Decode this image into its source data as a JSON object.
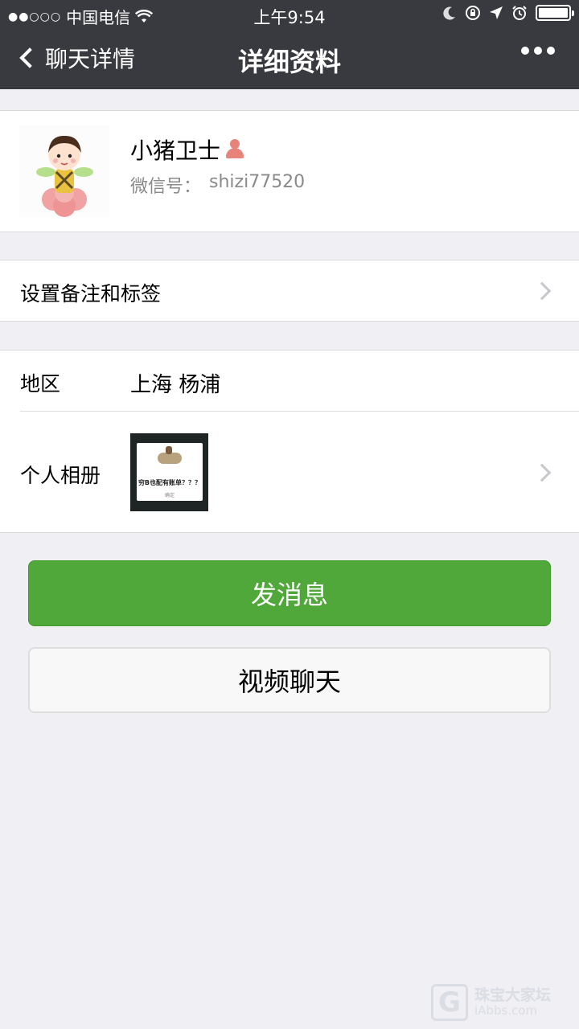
{
  "status_bar": {
    "signal": "●●○○○",
    "carrier": "中国电信",
    "wifi_icon": "wifi-icon",
    "time": "上午9:54",
    "icons": [
      "moon-icon",
      "rotation-lock-icon",
      "location-arrow-icon",
      "alarm-icon",
      "battery-icon"
    ]
  },
  "nav": {
    "back_label": "聊天详情",
    "title": "详细资料",
    "more_icon": "more-dots-icon"
  },
  "profile": {
    "name": "小猪卫士",
    "gender_icon": "female-icon",
    "wechat_id_label": "微信号：",
    "wechat_id": "shizi77520"
  },
  "remark": {
    "label": "设置备注和标签"
  },
  "info": {
    "region_label": "地区",
    "region_value": "上海  杨浦",
    "album_label": "个人相册",
    "album_thumb_text": "穷B也配有账单？？？",
    "album_thumb_button": "确定"
  },
  "actions": {
    "send_label": "发消息",
    "video_label": "视频聊天"
  },
  "watermark": {
    "title": "珠宝大家坛",
    "subtitle": "iAbbs.com"
  },
  "colors": {
    "nav_bg": "#393a3f",
    "primary_green": "#4fa839",
    "page_bg": "#efeff4"
  }
}
